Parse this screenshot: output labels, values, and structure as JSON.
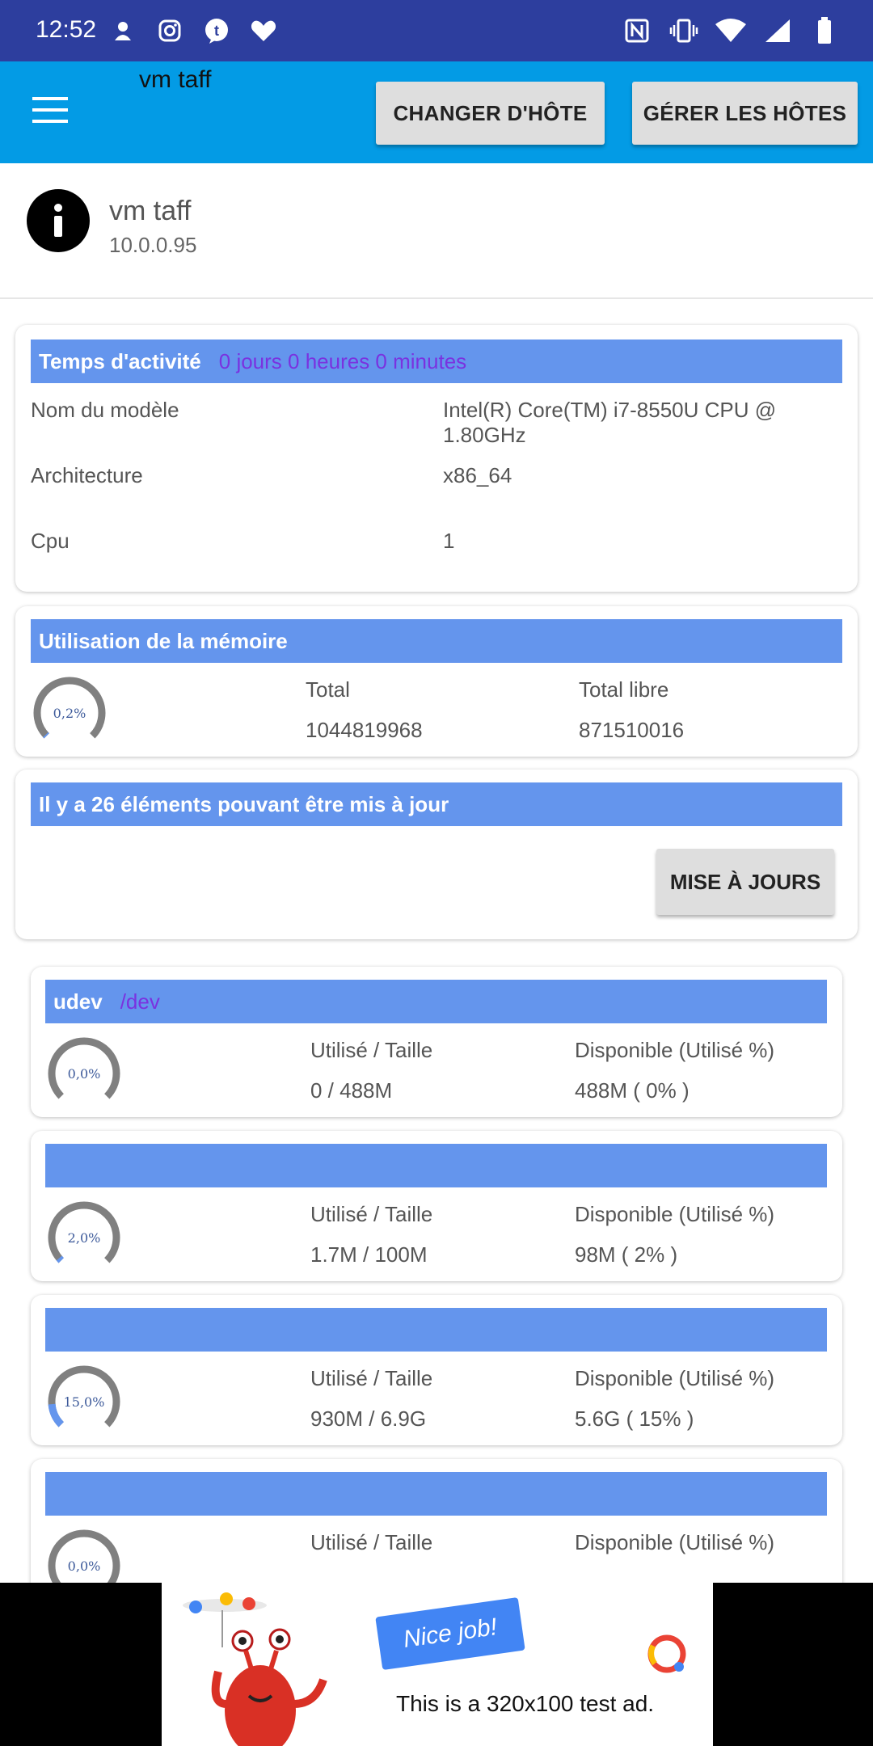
{
  "status_bar": {
    "time": "12:52",
    "left_icons": [
      "notification-icon",
      "instagram-icon",
      "tumblr-icon",
      "heart-icon"
    ],
    "right_icons": [
      "nfc-icon",
      "vibrate-icon",
      "wifi-icon",
      "signal-icon",
      "battery-icon"
    ]
  },
  "app_bar": {
    "title": "vm taff",
    "change_host_label": "CHANGER D'HÔTE",
    "manage_hosts_label": "GÉRER LES HÔTES"
  },
  "host": {
    "name": "vm taff",
    "ip": "10.0.0.95"
  },
  "system": {
    "uptime_label": "Temps d'activité",
    "uptime_value": "0 jours 0 heures 0 minutes",
    "rows": [
      {
        "label": "Nom du modèle",
        "value": "Intel(R) Core(TM) i7-8550U CPU @ 1.80GHz"
      },
      {
        "label": "Architecture",
        "value": "x86_64"
      },
      {
        "label": "Cpu",
        "value": "1"
      }
    ]
  },
  "memory": {
    "title": "Utilisation de la mémoire",
    "gauge_label": "0,2%",
    "gauge_fraction": 0.002,
    "total_label": "Total",
    "total_value": "1044819968",
    "free_label": "Total libre",
    "free_value": "871510016"
  },
  "updates": {
    "title": "Il y a 26 éléments pouvant être mis à jour",
    "button_label": "MISE À JOURS"
  },
  "disks": [
    {
      "name": "udev",
      "mount": "/dev",
      "gauge_label": "0,0%",
      "gauge_fraction": 0.0,
      "used_label": "Utilisé / Taille",
      "used_value": "0 / 488M",
      "avail_label": "Disponible (Utilisé %)",
      "avail_value": "488M ( 0% )"
    },
    {
      "name": "",
      "mount": "",
      "gauge_label": "2,0%",
      "gauge_fraction": 0.02,
      "used_label": "Utilisé / Taille",
      "used_value": "1.7M / 100M",
      "avail_label": "Disponible (Utilisé %)",
      "avail_value": "98M ( 2% )"
    },
    {
      "name": "",
      "mount": "",
      "gauge_label": "15,0%",
      "gauge_fraction": 0.15,
      "used_label": "Utilisé / Taille",
      "used_value": "930M / 6.9G",
      "avail_label": "Disponible (Utilisé %)",
      "avail_value": "5.6G ( 15% )"
    },
    {
      "name": "",
      "mount": "",
      "gauge_label": "0,0%",
      "gauge_fraction": 0.0,
      "used_label": "Utilisé / Taille",
      "used_value": "",
      "avail_label": "Disponible (Utilisé %)",
      "avail_value": ""
    }
  ],
  "ad": {
    "headline": "Nice job!",
    "text": "This is a 320x100 test ad."
  },
  "colors": {
    "status_bar": "#2d3e9e",
    "app_bar": "#039be5",
    "card_header": "#6495ed",
    "accent_text": "#7a32e0",
    "gauge_track": "#808080",
    "gauge_fill": "#6495ed"
  }
}
